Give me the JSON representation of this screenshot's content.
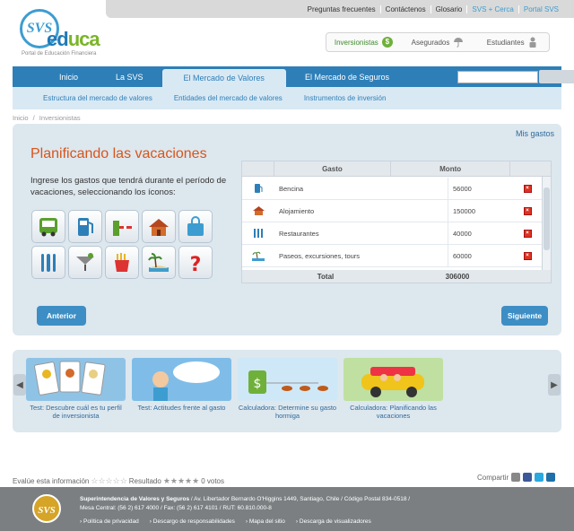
{
  "topbar": {
    "links": [
      "Preguntas frecuentes",
      "Contáctenos",
      "Glosario",
      "SVS + Cerca",
      "Portal SVS"
    ]
  },
  "logo": {
    "svs": "SVS",
    "educa_1": "ed",
    "educa_2": "uca",
    "subtitle": "Portal de Educación Financiera"
  },
  "profiles": [
    {
      "label": "Inversionistas",
      "icon": "dollar-icon"
    },
    {
      "label": "Asegurados",
      "icon": "umbrella-icon"
    },
    {
      "label": "Estudiantes",
      "icon": "student-icon"
    }
  ],
  "nav": {
    "items": [
      "Inicio",
      "La SVS",
      "El Mercado de Valores",
      "El Mercado de Seguros"
    ],
    "active_index": 2
  },
  "subnav": {
    "items": [
      "Estructura del mercado de valores",
      "Entidades del mercado de valores",
      "Instrumentos de inversión"
    ]
  },
  "breadcrumb": {
    "home": "Inicio",
    "sep": "/",
    "current": "Inversionistas"
  },
  "main": {
    "mis_gastos": "Mis gastos",
    "title": "Planificando las vacaciones",
    "instructions": "Ingrese los gastos que tendrá durante el período de vacaciones, seleccionando los íconos:",
    "icons": [
      "bus-icon",
      "fuel-pump-icon",
      "toll-gate-icon",
      "house-icon",
      "shopping-bag-icon",
      "cutlery-icon",
      "cocktail-icon",
      "fries-icon",
      "beach-icon",
      "question-icon"
    ],
    "table": {
      "headers": [
        "Gasto",
        "Monto"
      ],
      "rows": [
        {
          "icon": "fuel-pump-icon",
          "name": "Bencina",
          "amount": "56000"
        },
        {
          "icon": "house-icon",
          "name": "Alojamiento",
          "amount": "150000"
        },
        {
          "icon": "cutlery-icon",
          "name": "Restaurantes",
          "amount": "40000"
        },
        {
          "icon": "beach-icon",
          "name": "Paseos, excursiones, tours",
          "amount": "60000"
        }
      ],
      "total_label": "Total",
      "total_value": "306000"
    },
    "prev_label": "Anterior",
    "next_label": "Siguiente"
  },
  "carousel": {
    "items": [
      {
        "label": "Test: Descubre cuál es tu perfil de inversionista"
      },
      {
        "label": "Test: Actitudes frente al gasto"
      },
      {
        "label": "Calculadora: Determine su gasto hormiga"
      },
      {
        "label": "Calculadora: Planificando las vacaciones"
      }
    ]
  },
  "rating": {
    "label": "Evalúe esta información",
    "result_label": "Resultado",
    "votes": "0 votos"
  },
  "share": {
    "label": "Compartir"
  },
  "footer": {
    "logo": "SVS",
    "org": "Superintendencia de Valores y Seguros",
    "address": " / Av. Libertador Bernardo O'Higgins 1449, Santiago, Chile / Código Postal 834-0518 /",
    "contact": "Mesa Central: (56 2) 617 4000 / Fax: (56 2) 617 4101 / RUT: 60.810.000-8",
    "links": [
      "Política de privacidad",
      "Descargo de responsabilidades",
      "Mapa del sitio",
      "Descarga de visualizadores"
    ]
  },
  "colors": {
    "nav": "#2e7fb8",
    "title": "#d9541a",
    "panel": "#dde7ee",
    "footer": "#7b7f82"
  }
}
